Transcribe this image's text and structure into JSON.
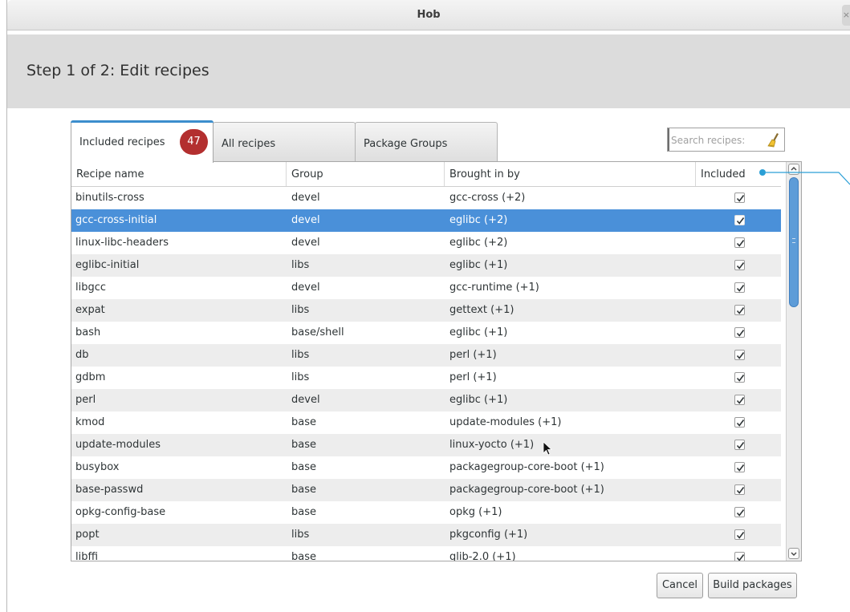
{
  "window": {
    "title": "Hob",
    "close_label": "×"
  },
  "header": {
    "step_title": "Step 1 of 2: Edit recipes"
  },
  "tabs": [
    {
      "label": "Included recipes",
      "badge": "47",
      "active": true
    },
    {
      "label": "All recipes",
      "active": false
    },
    {
      "label": "Package Groups",
      "active": false
    }
  ],
  "search": {
    "placeholder": "Search recipes:",
    "value": ""
  },
  "table": {
    "columns": [
      "Recipe name",
      "Group",
      "Brought in by",
      "Included"
    ],
    "rows": [
      {
        "name": "binutils-cross",
        "group": "devel",
        "brought_in_by": "gcc-cross (+2)",
        "included": true
      },
      {
        "name": "gcc-cross-initial",
        "group": "devel",
        "brought_in_by": "eglibc (+2)",
        "included": true,
        "selected": true
      },
      {
        "name": "linux-libc-headers",
        "group": "devel",
        "brought_in_by": "eglibc (+2)",
        "included": true
      },
      {
        "name": "eglibc-initial",
        "group": "libs",
        "brought_in_by": "eglibc (+1)",
        "included": true
      },
      {
        "name": "libgcc",
        "group": "devel",
        "brought_in_by": "gcc-runtime (+1)",
        "included": true
      },
      {
        "name": "expat",
        "group": "libs",
        "brought_in_by": "gettext (+1)",
        "included": true
      },
      {
        "name": "bash",
        "group": "base/shell",
        "brought_in_by": "eglibc (+1)",
        "included": true
      },
      {
        "name": "db",
        "group": "libs",
        "brought_in_by": "perl (+1)",
        "included": true
      },
      {
        "name": "gdbm",
        "group": "libs",
        "brought_in_by": "perl (+1)",
        "included": true
      },
      {
        "name": "perl",
        "group": "devel",
        "brought_in_by": "eglibc (+1)",
        "included": true
      },
      {
        "name": "kmod",
        "group": "base",
        "brought_in_by": "update-modules (+1)",
        "included": true
      },
      {
        "name": "update-modules",
        "group": "base",
        "brought_in_by": "linux-yocto (+1)",
        "included": true
      },
      {
        "name": "busybox",
        "group": "base",
        "brought_in_by": "packagegroup-core-boot (+1)",
        "included": true
      },
      {
        "name": "base-passwd",
        "group": "base",
        "brought_in_by": "packagegroup-core-boot (+1)",
        "included": true
      },
      {
        "name": "opkg-config-base",
        "group": "base",
        "brought_in_by": "opkg (+1)",
        "included": true
      },
      {
        "name": "popt",
        "group": "libs",
        "brought_in_by": "pkgconfig (+1)",
        "included": true
      },
      {
        "name": "libffi",
        "group": "base",
        "brought_in_by": "glib-2.0 (+1)",
        "included": true
      }
    ]
  },
  "buttons": {
    "cancel": "Cancel",
    "build": "Build packages"
  },
  "colors": {
    "selection": "#4a90d9",
    "badge": "#b32f2f",
    "accent": "#3c8ecd",
    "scroll_thumb": "#5d9cd8"
  },
  "icons": {
    "search_clear": "broom-icon",
    "checkbox": "check-icon"
  }
}
